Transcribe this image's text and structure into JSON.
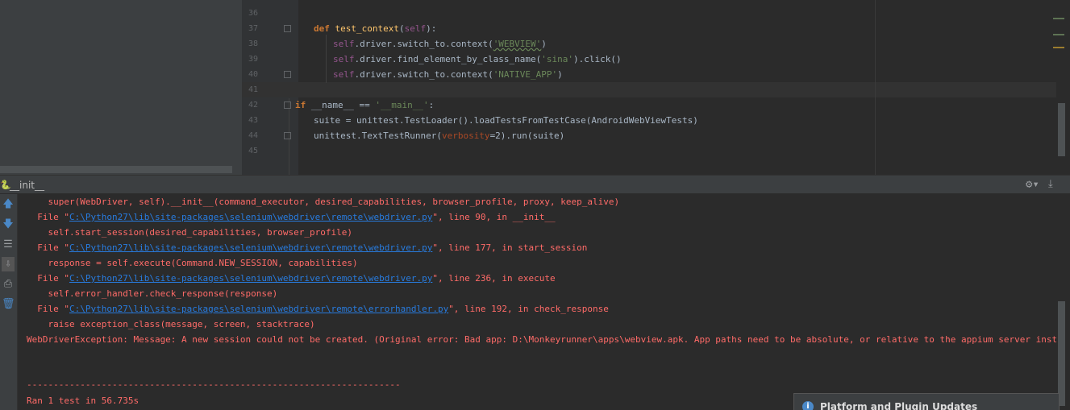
{
  "editor": {
    "line_numbers": [
      "36",
      "37",
      "38",
      "39",
      "40",
      "41",
      "42",
      "43",
      "44",
      "45"
    ],
    "line37": {
      "def": "def",
      "name": "test_context",
      "open": "(",
      "self": "self",
      "close": "):"
    },
    "line38": {
      "self": "self",
      "call": ".driver.switch_to.context(",
      "str": "'WEBVIEW'",
      "close": ")"
    },
    "line39": {
      "self": "self",
      "call": ".driver.find_element_by_class_name(",
      "str": "'sina'",
      "close": ").click()"
    },
    "line40": {
      "self": "self",
      "call": ".driver.switch_to.context(",
      "str": "'NATIVE_APP'",
      "close": ")"
    },
    "line42": {
      "if": "if",
      "name": "__name__",
      "eq": " == ",
      "str": "'__main__'",
      "colon": ":"
    },
    "line43": {
      "text": "suite = unittest.TestLoader().loadTestsFromTestCase(AndroidWebViewTests)"
    },
    "line44": {
      "pre": "unittest.TextTestRunner(",
      "param": "verbosity",
      "post": "=2).run(suite)"
    }
  },
  "run": {
    "title": "__init__",
    "icons": [
      "arrow-up-icon",
      "arrow-down-icon",
      "soft-wrap-icon",
      "scroll-to-end-icon",
      "print-icon",
      "trash-icon",
      "gear-icon",
      "pin-icon"
    ]
  },
  "console": {
    "lines": [
      {
        "text": "    super(WebDriver, self).__init__(command_executor, desired_capabilities, browser_profile, proxy, keep_alive)"
      },
      {
        "pre": "  File \"",
        "link": "C:\\Python27\\lib\\site-packages\\selenium\\webdriver\\remote\\webdriver.py",
        "post": "\", line 90, in __init__"
      },
      {
        "text": "    self.start_session(desired_capabilities, browser_profile)"
      },
      {
        "pre": "  File \"",
        "link": "C:\\Python27\\lib\\site-packages\\selenium\\webdriver\\remote\\webdriver.py",
        "post": "\", line 177, in start_session"
      },
      {
        "text": "    response = self.execute(Command.NEW_SESSION, capabilities)"
      },
      {
        "pre": "  File \"",
        "link": "C:\\Python27\\lib\\site-packages\\selenium\\webdriver\\remote\\webdriver.py",
        "post": "\", line 236, in execute"
      },
      {
        "text": "    self.error_handler.check_response(response)"
      },
      {
        "pre": "  File \"",
        "link": "C:\\Python27\\lib\\site-packages\\selenium\\webdriver\\remote\\errorhandler.py",
        "post": "\", line 192, in check_response"
      },
      {
        "text": "    raise exception_class(message, screen, stacktrace)"
      },
      {
        "text": "WebDriverException: Message: A new session could not be created. (Original error: Bad app: D:\\Monkeyrunner\\apps\\webview.apk. App paths need to be absolute, or relative to the appium server install dir, or a URL to compressed file, or a special app name.)"
      },
      {
        "text": "----------------------------------------------------------------------"
      },
      {
        "text": "Ran 1 test in 56.735s"
      }
    ]
  },
  "notification": {
    "title": "Platform and Plugin Updates"
  },
  "colors": {
    "background": "#2b2b2b",
    "error_text": "#ff6b68",
    "link": "#287bde",
    "keyword": "#cc7832",
    "string": "#6a8759"
  }
}
